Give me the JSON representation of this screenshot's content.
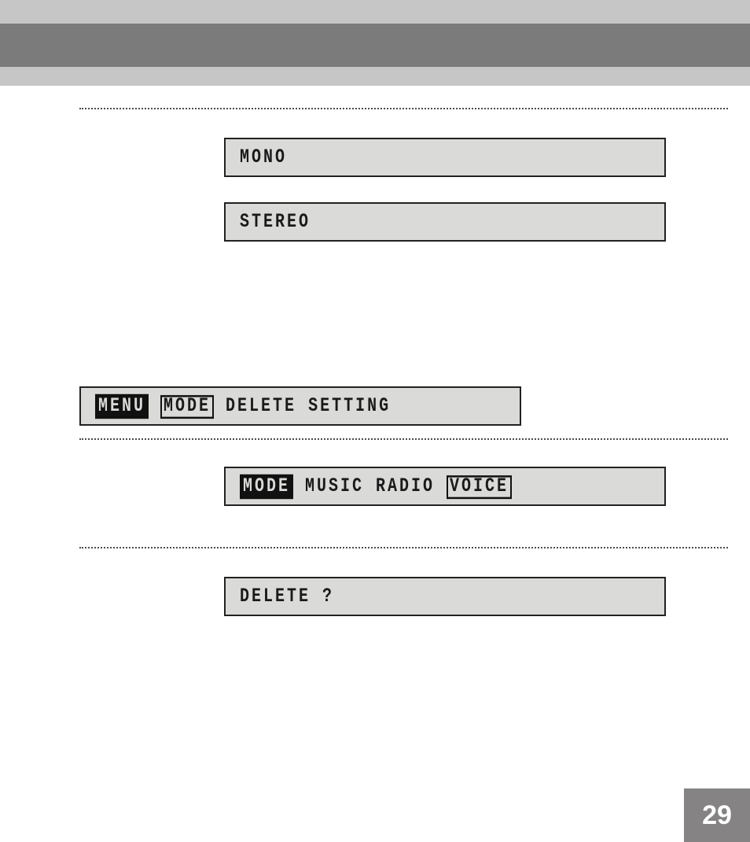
{
  "page_number": "29",
  "boxes": {
    "mono": "MONO",
    "stereo": "STEREO",
    "delete_setting": {
      "tokens": [
        {
          "text": "MENU",
          "style": "inverse"
        },
        {
          "text": " ",
          "style": "plain"
        },
        {
          "text": "MODE",
          "style": "boxed"
        },
        {
          "text": " DELETE SETTING",
          "style": "plain"
        }
      ]
    },
    "mode_row": {
      "tokens": [
        {
          "text": "MODE",
          "style": "inverse"
        },
        {
          "text": " MUSIC RADIO ",
          "style": "plain"
        },
        {
          "text": "VOICE",
          "style": "boxed"
        }
      ]
    },
    "delete_confirm": "DELETE ?"
  }
}
